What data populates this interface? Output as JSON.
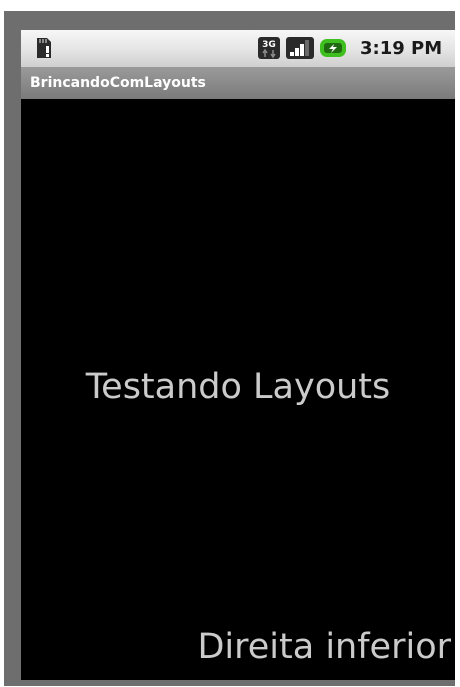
{
  "status_bar": {
    "time": "3:19 PM",
    "network_type": "3G",
    "icons": [
      "sd-card-icon",
      "3g-data-icon",
      "signal-strength-icon",
      "battery-charging-icon"
    ]
  },
  "title_bar": {
    "title": "BrincandoComLayouts"
  },
  "content": {
    "center_label": "Testando Layouts",
    "bottom_right_label": "Direita inferior"
  },
  "colors": {
    "background": "#000000",
    "text": "#cbcbcb",
    "title_bar": "#8a8a8a",
    "battery_accent": "#3fbf1f"
  }
}
